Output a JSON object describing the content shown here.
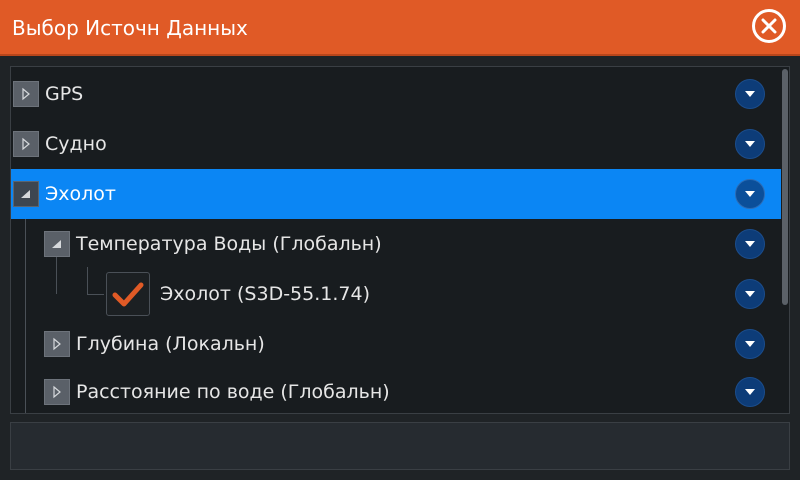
{
  "dialog": {
    "title": "Выбор Источн Данных",
    "accent_color": "#e05a26",
    "close_icon": "close-circle-icon"
  },
  "tree": {
    "selected_color": "#0b86f4",
    "rows": [
      {
        "label": "GPS",
        "expanded": false,
        "selected": false,
        "level": 0
      },
      {
        "label": "Судно",
        "expanded": false,
        "selected": false,
        "level": 0
      },
      {
        "label": "Эхолот",
        "expanded": true,
        "selected": true,
        "level": 0
      },
      {
        "label": "Температура Воды (Глобальн)",
        "expanded": true,
        "selected": false,
        "level": 1
      },
      {
        "label": "Эхолот (S3D-55.1.74)",
        "checked": true,
        "selected": false,
        "level": 2
      },
      {
        "label": "Глубина (Локальн)",
        "expanded": false,
        "selected": false,
        "level": 1
      },
      {
        "label": "Расстояние по воде (Глобальн)",
        "expanded": false,
        "selected": false,
        "level": 1
      }
    ]
  },
  "footer": {
    "text": ""
  }
}
